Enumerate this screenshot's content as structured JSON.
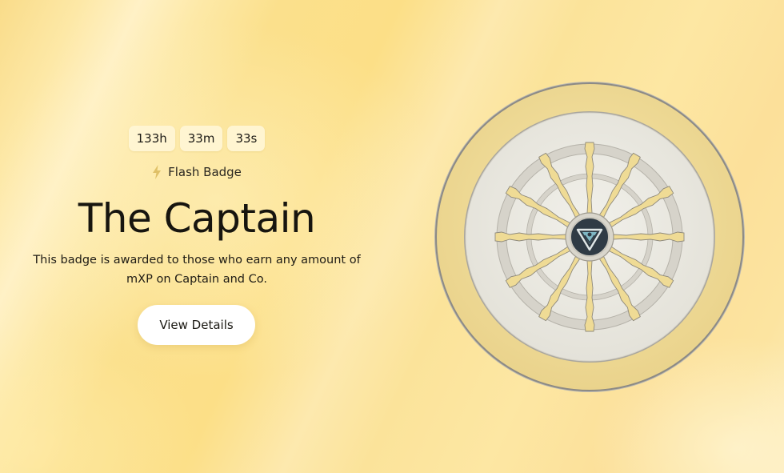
{
  "timer": {
    "hours": "133h",
    "minutes": "33m",
    "seconds": "33s"
  },
  "badge": {
    "kind_label": "Flash Badge",
    "kind_icon": "lightning-bolt-icon",
    "title": "The Captain",
    "description": "This badge is awarded to those who earn any amount of mXP on Captain and Co.",
    "image_icon": "ship-wheel-badge-icon"
  },
  "actions": {
    "view_details_label": "View Details"
  },
  "colors": {
    "background": "#fce08c",
    "badge_rim": "#f0dc9a",
    "badge_face": "#ecebe3",
    "spokes": "#f0dc94",
    "emblem_dark": "#2f3b45",
    "emblem_teal": "#7fb7c4",
    "text": "#17150f",
    "button_bg": "#ffffff"
  }
}
